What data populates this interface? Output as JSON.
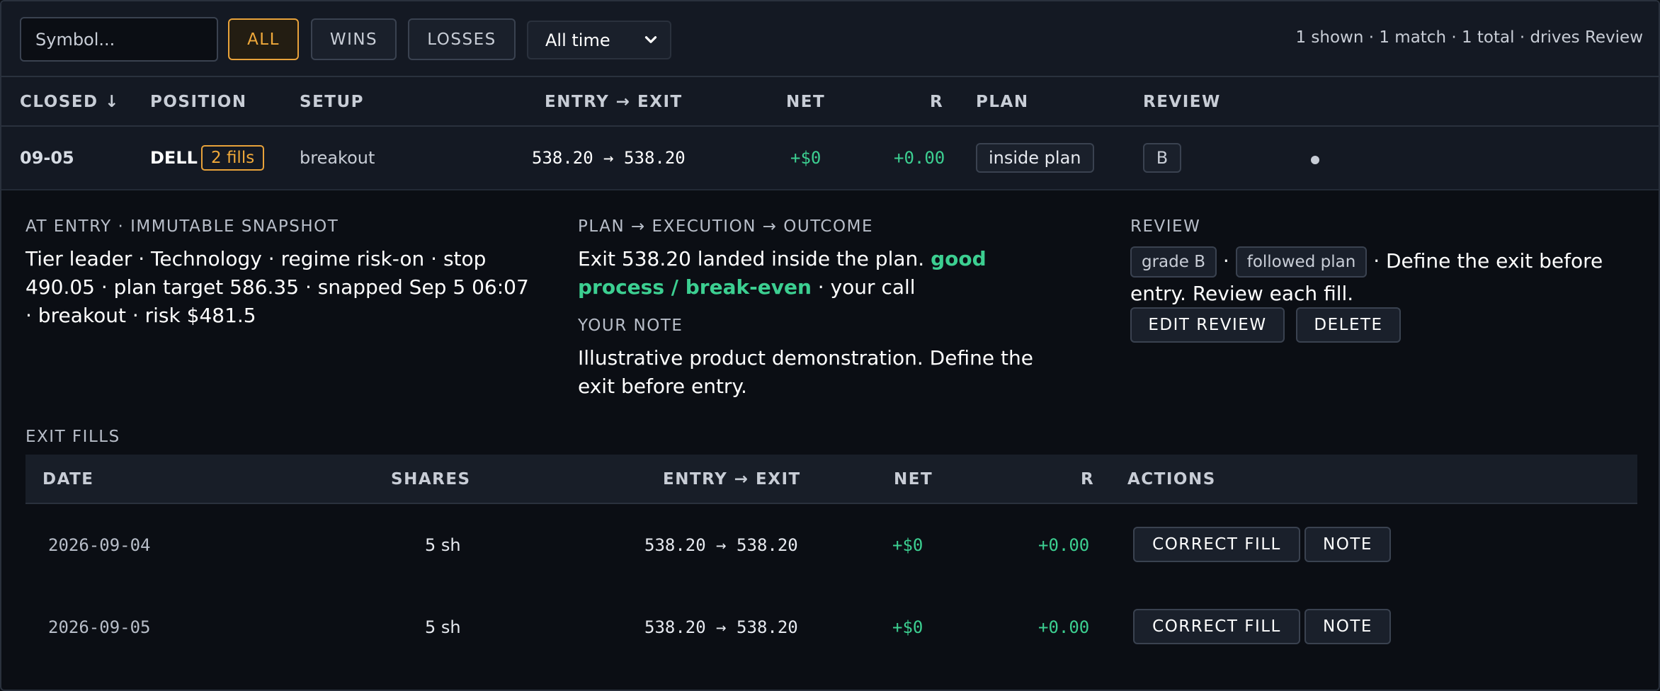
{
  "toolbar": {
    "search_placeholder": "Symbol...",
    "filters": [
      "ALL",
      "WINS",
      "LOSSES"
    ],
    "active_filter": "ALL",
    "range_value": "All time",
    "status_text": "1 shown · 1 match · 1 total · drives Review"
  },
  "columns": {
    "closed": "CLOSED ↓",
    "position": "POSITION",
    "setup": "SETUP",
    "entry_exit": "ENTRY → EXIT",
    "net": "NET",
    "r": "R",
    "plan": "PLAN",
    "review": "REVIEW"
  },
  "trade": {
    "closed": "09-05",
    "symbol": "DELL",
    "fills_badge": "2 fills",
    "setup": "breakout",
    "entry_exit": "538.20 → 538.20",
    "net": "+$0",
    "r": "+0.00",
    "plan": "inside plan",
    "review_grade": "B"
  },
  "detail": {
    "snapshot_label": "AT ENTRY · IMMUTABLE SNAPSHOT",
    "snapshot_text": "Tier leader · Technology · regime risk-on · stop 490.05 · plan target 586.35 · snapped Sep 5 06:07 · breakout · risk $481.5",
    "outcome_label": "PLAN → EXECUTION → OUTCOME",
    "outcome_prefix": "Exit 538.20 landed inside the plan.",
    "outcome_highlight": "good process / break-even",
    "outcome_suffix": "· your call",
    "note_label": "YOUR NOTE",
    "note_text": "Illustrative product demonstration. Define the exit before entry.",
    "review_label": "REVIEW",
    "review_grade_tag": "grade B",
    "review_sep": "·",
    "review_plan_tag": "followed plan",
    "review_text": "· Define the exit before entry. Review each fill.",
    "edit_review_label": "EDIT REVIEW",
    "delete_label": "DELETE"
  },
  "fills": {
    "label": "EXIT FILLS",
    "columns": {
      "date": "DATE",
      "shares": "SHARES",
      "entry_exit": "ENTRY → EXIT",
      "net": "NET",
      "r": "R",
      "actions": "ACTIONS"
    },
    "rows": [
      {
        "date": "2026-09-04",
        "shares": "5 sh",
        "entry_exit": "538.20 → 538.20",
        "net": "+$0",
        "r": "+0.00"
      },
      {
        "date": "2026-09-05",
        "shares": "5 sh",
        "entry_exit": "538.20 → 538.20",
        "net": "+$0",
        "r": "+0.00"
      }
    ],
    "correct_label": "CORRECT FILL",
    "note_label": "NOTE"
  },
  "colors": {
    "background": "#0b0e14",
    "accent_orange": "#f0a93a",
    "positive_green": "#3ccf91"
  }
}
